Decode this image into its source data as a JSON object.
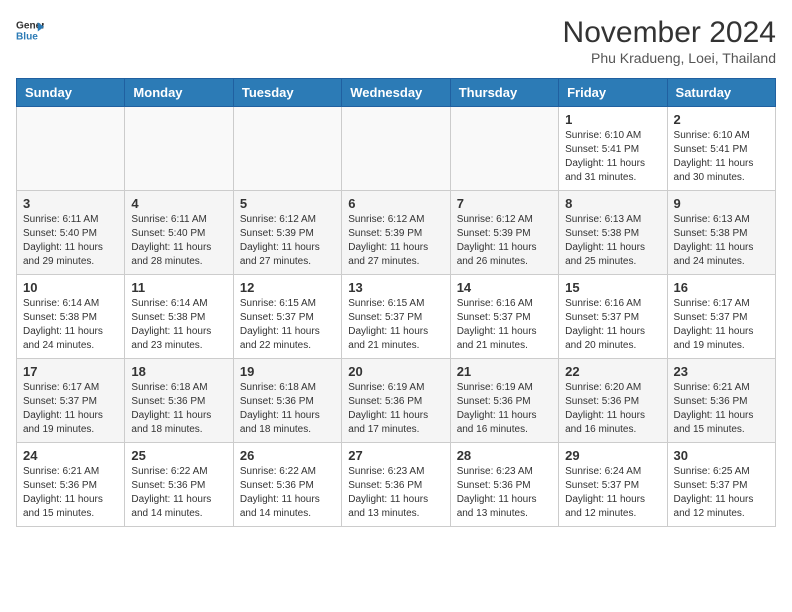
{
  "header": {
    "logo": {
      "line1": "General",
      "line2": "Blue"
    },
    "title": "November 2024",
    "location": "Phu Kradueng, Loei, Thailand"
  },
  "weekdays": [
    "Sunday",
    "Monday",
    "Tuesday",
    "Wednesday",
    "Thursday",
    "Friday",
    "Saturday"
  ],
  "weeks": [
    [
      {
        "day": "",
        "info": ""
      },
      {
        "day": "",
        "info": ""
      },
      {
        "day": "",
        "info": ""
      },
      {
        "day": "",
        "info": ""
      },
      {
        "day": "",
        "info": ""
      },
      {
        "day": "1",
        "info": "Sunrise: 6:10 AM\nSunset: 5:41 PM\nDaylight: 11 hours\nand 31 minutes."
      },
      {
        "day": "2",
        "info": "Sunrise: 6:10 AM\nSunset: 5:41 PM\nDaylight: 11 hours\nand 30 minutes."
      }
    ],
    [
      {
        "day": "3",
        "info": "Sunrise: 6:11 AM\nSunset: 5:40 PM\nDaylight: 11 hours\nand 29 minutes."
      },
      {
        "day": "4",
        "info": "Sunrise: 6:11 AM\nSunset: 5:40 PM\nDaylight: 11 hours\nand 28 minutes."
      },
      {
        "day": "5",
        "info": "Sunrise: 6:12 AM\nSunset: 5:39 PM\nDaylight: 11 hours\nand 27 minutes."
      },
      {
        "day": "6",
        "info": "Sunrise: 6:12 AM\nSunset: 5:39 PM\nDaylight: 11 hours\nand 27 minutes."
      },
      {
        "day": "7",
        "info": "Sunrise: 6:12 AM\nSunset: 5:39 PM\nDaylight: 11 hours\nand 26 minutes."
      },
      {
        "day": "8",
        "info": "Sunrise: 6:13 AM\nSunset: 5:38 PM\nDaylight: 11 hours\nand 25 minutes."
      },
      {
        "day": "9",
        "info": "Sunrise: 6:13 AM\nSunset: 5:38 PM\nDaylight: 11 hours\nand 24 minutes."
      }
    ],
    [
      {
        "day": "10",
        "info": "Sunrise: 6:14 AM\nSunset: 5:38 PM\nDaylight: 11 hours\nand 24 minutes."
      },
      {
        "day": "11",
        "info": "Sunrise: 6:14 AM\nSunset: 5:38 PM\nDaylight: 11 hours\nand 23 minutes."
      },
      {
        "day": "12",
        "info": "Sunrise: 6:15 AM\nSunset: 5:37 PM\nDaylight: 11 hours\nand 22 minutes."
      },
      {
        "day": "13",
        "info": "Sunrise: 6:15 AM\nSunset: 5:37 PM\nDaylight: 11 hours\nand 21 minutes."
      },
      {
        "day": "14",
        "info": "Sunrise: 6:16 AM\nSunset: 5:37 PM\nDaylight: 11 hours\nand 21 minutes."
      },
      {
        "day": "15",
        "info": "Sunrise: 6:16 AM\nSunset: 5:37 PM\nDaylight: 11 hours\nand 20 minutes."
      },
      {
        "day": "16",
        "info": "Sunrise: 6:17 AM\nSunset: 5:37 PM\nDaylight: 11 hours\nand 19 minutes."
      }
    ],
    [
      {
        "day": "17",
        "info": "Sunrise: 6:17 AM\nSunset: 5:37 PM\nDaylight: 11 hours\nand 19 minutes."
      },
      {
        "day": "18",
        "info": "Sunrise: 6:18 AM\nSunset: 5:36 PM\nDaylight: 11 hours\nand 18 minutes."
      },
      {
        "day": "19",
        "info": "Sunrise: 6:18 AM\nSunset: 5:36 PM\nDaylight: 11 hours\nand 18 minutes."
      },
      {
        "day": "20",
        "info": "Sunrise: 6:19 AM\nSunset: 5:36 PM\nDaylight: 11 hours\nand 17 minutes."
      },
      {
        "day": "21",
        "info": "Sunrise: 6:19 AM\nSunset: 5:36 PM\nDaylight: 11 hours\nand 16 minutes."
      },
      {
        "day": "22",
        "info": "Sunrise: 6:20 AM\nSunset: 5:36 PM\nDaylight: 11 hours\nand 16 minutes."
      },
      {
        "day": "23",
        "info": "Sunrise: 6:21 AM\nSunset: 5:36 PM\nDaylight: 11 hours\nand 15 minutes."
      }
    ],
    [
      {
        "day": "24",
        "info": "Sunrise: 6:21 AM\nSunset: 5:36 PM\nDaylight: 11 hours\nand 15 minutes."
      },
      {
        "day": "25",
        "info": "Sunrise: 6:22 AM\nSunset: 5:36 PM\nDaylight: 11 hours\nand 14 minutes."
      },
      {
        "day": "26",
        "info": "Sunrise: 6:22 AM\nSunset: 5:36 PM\nDaylight: 11 hours\nand 14 minutes."
      },
      {
        "day": "27",
        "info": "Sunrise: 6:23 AM\nSunset: 5:36 PM\nDaylight: 11 hours\nand 13 minutes."
      },
      {
        "day": "28",
        "info": "Sunrise: 6:23 AM\nSunset: 5:36 PM\nDaylight: 11 hours\nand 13 minutes."
      },
      {
        "day": "29",
        "info": "Sunrise: 6:24 AM\nSunset: 5:37 PM\nDaylight: 11 hours\nand 12 minutes."
      },
      {
        "day": "30",
        "info": "Sunrise: 6:25 AM\nSunset: 5:37 PM\nDaylight: 11 hours\nand 12 minutes."
      }
    ]
  ],
  "colors": {
    "header_bg": "#2c7bb6",
    "logo_blue": "#2c7bb6"
  }
}
